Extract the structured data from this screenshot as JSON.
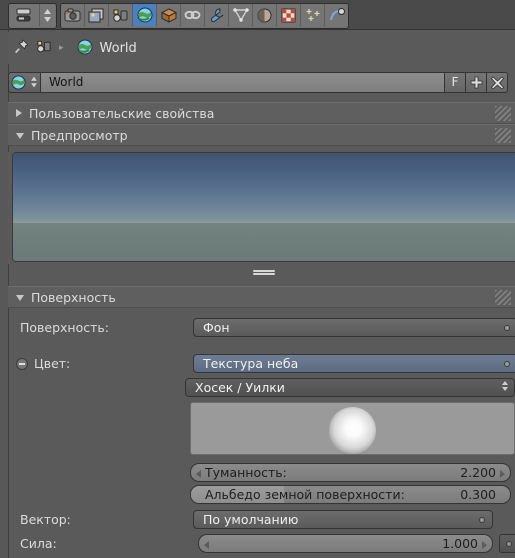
{
  "window": {
    "title": "Blender Properties Editor - World"
  },
  "toolbar": {
    "editor_type_icon": "editor-type-icon",
    "tabs": [
      {
        "name": "render-tab",
        "icon": "camera-icon",
        "active": false
      },
      {
        "name": "render-layers-tab",
        "icon": "render-layers-icon",
        "active": false
      },
      {
        "name": "scene-tab",
        "icon": "scene-icon",
        "active": false
      },
      {
        "name": "world-tab",
        "icon": "world-globe-icon",
        "active": true
      },
      {
        "name": "object-tab",
        "icon": "object-cube-icon",
        "active": false
      },
      {
        "name": "constraints-tab",
        "icon": "chain-link-icon",
        "active": false
      },
      {
        "name": "modifiers-tab",
        "icon": "wrench-icon",
        "active": false
      },
      {
        "name": "object-data-tab",
        "icon": "triangle-mesh-icon",
        "active": false
      },
      {
        "name": "material-tab",
        "icon": "material-sphere-icon",
        "active": false
      },
      {
        "name": "texture-tab",
        "icon": "checker-texture-icon",
        "active": false
      },
      {
        "name": "particles-tab",
        "icon": "particles-icon",
        "active": false
      },
      {
        "name": "physics-tab",
        "icon": "physics-orbit-icon",
        "active": false
      }
    ]
  },
  "breadcrumb": {
    "pin_icon": "pin-icon",
    "scene_icon": "scene-icon",
    "separator": "▸",
    "world_icon": "world-globe-icon",
    "world_label": "World"
  },
  "datablock": {
    "prefix_icon": "world-globe-icon",
    "browse_icon": "⇅",
    "name": "World",
    "fake_user_label": "F",
    "new_label": "+",
    "unlink_label": "✕"
  },
  "panels": [
    {
      "name": "custom-properties",
      "title": "Пользовательские свойства",
      "open": false
    },
    {
      "name": "preview",
      "title": "Предпросмотр",
      "open": true
    },
    {
      "name": "surface",
      "title": "Поверхность",
      "open": true
    }
  ],
  "surface": {
    "surface_label": "Поверхность:",
    "surface_value": "Фон",
    "color_label": "Цвет:",
    "color_value": "Текстура неба",
    "sky_model_value": "Хосек / Уилки",
    "sun_preview_name": "sun-direction-preview",
    "turbidity_label": "Туманность:",
    "turbidity_value": "2.200",
    "albedo_label": "Альбедо земной поверхности:",
    "albedo_value": "0.300",
    "vector_label": "Вектор:",
    "vector_value": "По умолчанию",
    "strength_label": "Сила:",
    "strength_value": "1.000"
  },
  "colors": {
    "accent": "#4a7fc1",
    "panel_bg": "#5a5a5a",
    "header_bg": "#4a4a4a",
    "field_bg": "#636363",
    "field_blue": "#66758a",
    "text": "#dcdcdc"
  }
}
